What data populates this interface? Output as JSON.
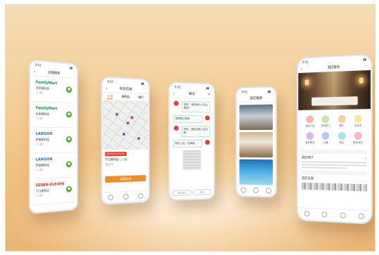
{
  "phones": {
    "store_list": {
      "title": "店铺搜索",
      "stores": [
        {
          "brand": "FamilyMart",
          "name": "全家便利店",
          "addr": "○○店"
        },
        {
          "brand": "FamilyMart",
          "name": "全家便利店",
          "addr": "○○店"
        },
        {
          "brand": "LAWSON",
          "name": "罗森便利店",
          "addr": "○○店"
        },
        {
          "brand": "LAWSON",
          "name": "罗森便利店",
          "addr": "○○店"
        },
        {
          "brand": "SEVEN-ELEVEN",
          "name": "711便利店",
          "addr": "○○店"
        }
      ]
    },
    "map": {
      "title": "附近店铺",
      "tabs": [
        "全部",
        "便利店",
        "餐厅"
      ],
      "shop_brand": "SEVEN-ELEVEN",
      "shop_name": "711便利店 ○○店",
      "shop_sub": "营业中",
      "button": "查看店铺"
    },
    "chat": {
      "title": "聊天",
      "messages": [
        "您好，请问有什么可以帮您？",
        "我想预订房间",
        "好的，请告诉我入住日期",
        "明天入住，住两晚"
      ],
      "input_left": "发送消息",
      "input_right": "发送"
    },
    "photos": {
      "title": "酒店相册"
    },
    "hotel": {
      "title": "酒店服务",
      "icons": [
        "酒店介绍",
        "房间预订",
        "餐厅",
        "会议室",
        "客房服务",
        "交通",
        "周边",
        "联系我们"
      ],
      "section1": "酒店简介",
      "section2": "酒店设施"
    }
  },
  "colors": {
    "accent_orange": "#f28c28",
    "pin_green": "#5aa83a",
    "chat_red": "#e0413a"
  }
}
